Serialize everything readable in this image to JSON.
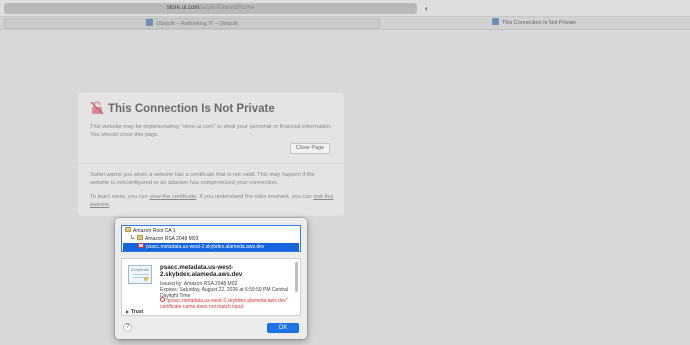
{
  "browser": {
    "address_host": "store.ui.com",
    "address_path": "/super/forward/home",
    "tabs": [
      {
        "label": "Ubiquiti – Rethinking IT – Ubiquiti",
        "active": false
      },
      {
        "label": "This Connection Is Not Private",
        "active": true
      }
    ],
    "shield_icon": "half-shield-icon"
  },
  "warning": {
    "icon": "broken-lock-icon",
    "title": "This Connection Is Not Private",
    "body": "This website may be impersonating “store.ui.com” to steal your personal or financial information. You should close this page.",
    "close_button": "Close Page",
    "details_text": "Safari warns you when a website has a certificate that is not valid. This may happen if the website is misconfigured or an attacker has compromised your connection.",
    "learn_prefix": "To learn more, you can ",
    "view_cert_link": "view the certificate",
    "learn_middle": ". If you understand the risks involved, you can ",
    "visit_link": "visit this website",
    "learn_suffix": "."
  },
  "certificate_sheet": {
    "chain": [
      "Amazon Root CA 1",
      "Amazon RSA 2048 M03",
      "psacc.metadata.us-west-2.skybdex.alameda.aws.dev"
    ],
    "cert_name": "psacc.metadata.us-west-2.skybdex.alameda.aws.dev",
    "issued_by": "Issued by: Amazon RSA 2048 M03",
    "expires": "Expires: Saturday, August 22, 2026 at 6:59:59 PM Central Daylight Time",
    "error": "“psacc.metadata.us-west-2.skybdex.alameda.aws.dev” certificate name does not match input",
    "cert_image_text": "Certificate",
    "trust_label": "Trust",
    "help_label": "?",
    "ok_label": "OK"
  },
  "colors": {
    "accent": "#1a73e8",
    "error": "#dd3333",
    "selection": "#1564dc"
  }
}
